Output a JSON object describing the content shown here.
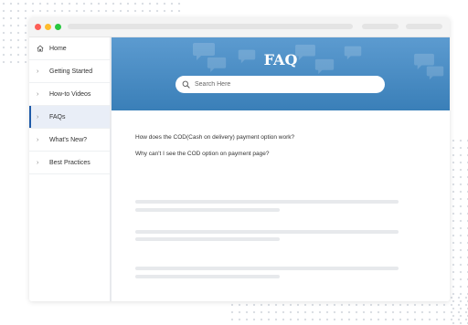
{
  "window": {
    "traffic_lights": [
      "#fe5f57",
      "#febc2e",
      "#28c840"
    ]
  },
  "sidebar": {
    "items": [
      {
        "label": "Home",
        "icon": "home-icon"
      },
      {
        "label": "Getting Started",
        "icon": "chevron-right-icon"
      },
      {
        "label": "How-to Videos",
        "icon": "chevron-right-icon"
      },
      {
        "label": "FAQs",
        "icon": "chevron-right-icon",
        "active": true
      },
      {
        "label": "What's New?",
        "icon": "chevron-right-icon"
      },
      {
        "label": "Best Practices",
        "icon": "chevron-right-icon"
      }
    ]
  },
  "hero": {
    "title": "FAQ",
    "background": "#4a8cc4",
    "search": {
      "placeholder": "Search Here",
      "icon": "search-icon"
    }
  },
  "faq": {
    "questions": [
      "How does the COD(Cash on delivery) payment option work?",
      "Why can't I see the COD option on payment page?"
    ]
  },
  "colors": {
    "accent": "#1f5ba8",
    "active_bg": "#e9eef7",
    "skeleton": "#e7e9ec"
  }
}
